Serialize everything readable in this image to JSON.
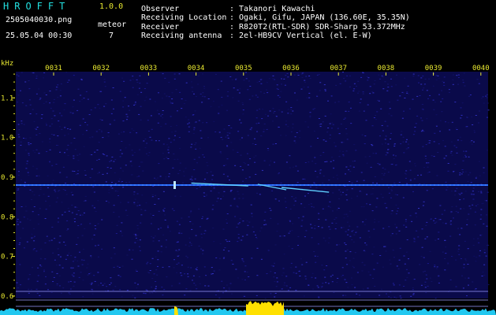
{
  "app": {
    "title": "HROFFT",
    "version": "1.0.0"
  },
  "file": {
    "name": "2505040030.png",
    "datetime": "25.05.04 00:30"
  },
  "detection": {
    "label": "meteor",
    "count": "7"
  },
  "station": {
    "observer_label": "Observer",
    "observer_value": ": Takanori Kawachi",
    "location_label": "Receiving Location",
    "location_value": ": Ogaki, Gifu, JAPAN (136.60E, 35.35N)",
    "receiver_label": "Receiver",
    "receiver_value": ": R820T2(RTL-SDR) SDR-Sharp 53.372MHz",
    "antenna_label": "Receiving antenna",
    "antenna_value": ": 2el-HB9CV Vertical (el. E-W)"
  },
  "colors": {
    "title": "#22e0e0",
    "accent": "#e8e830",
    "background": "#000000",
    "waterfall_bg": "#0a0a4a",
    "noise_floor": "#22c8f0",
    "signal": "#ffe000"
  },
  "chart_data": {
    "type": "heatmap",
    "ylabel": "kHz",
    "x_ticks": [
      "0031",
      "0032",
      "0033",
      "0034",
      "0035",
      "0036",
      "0037",
      "0038",
      "0039",
      "0040"
    ],
    "y_ticks": [
      "1.1",
      "1.0",
      "0.9",
      "0.8",
      "0.7",
      "0.6"
    ],
    "ylim": [
      0.58,
      1.18
    ],
    "carrier_khz": 0.88,
    "echoes": [
      {
        "start_min": 33.9,
        "end_min": 35.1,
        "khz_start": 0.885,
        "khz_end": 0.878
      },
      {
        "start_min": 35.3,
        "end_min": 35.9,
        "khz_start": 0.882,
        "khz_end": 0.868
      },
      {
        "start_min": 35.8,
        "end_min": 36.8,
        "khz_start": 0.874,
        "khz_end": 0.862
      }
    ],
    "grid": false
  }
}
